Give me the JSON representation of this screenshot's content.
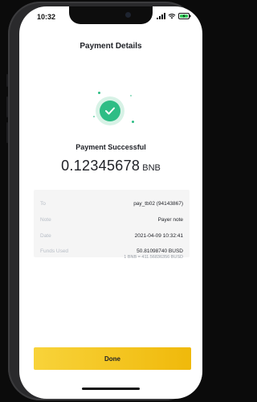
{
  "status_bar": {
    "time": "10:32"
  },
  "header": {
    "title": "Payment Details"
  },
  "result": {
    "status": "Payment Successful",
    "amount": "0.12345678",
    "currency": "BNB",
    "accent_color": "#2ebd85"
  },
  "details": {
    "rows": [
      {
        "label": "To",
        "value": "pay_tb02 (94143867)"
      },
      {
        "label": "Note",
        "value": "Payer note"
      },
      {
        "label": "Date",
        "value": "2021-04-09 10:32:41"
      },
      {
        "label": "Funds Used",
        "value": "50.81098740 BUSD",
        "sub": "1 BNB = 411.56836356 BUSD"
      }
    ]
  },
  "actions": {
    "done_label": "Done",
    "button_color": "#f0b90b"
  }
}
